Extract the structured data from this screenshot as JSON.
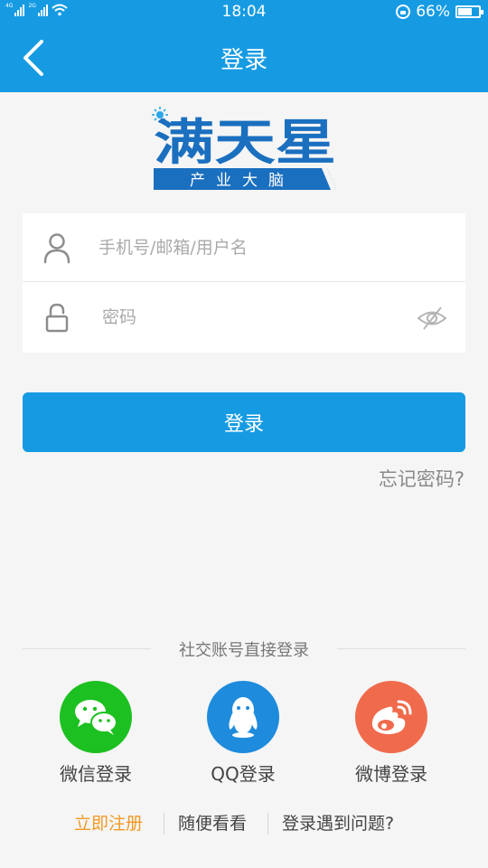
{
  "status_bar": {
    "network_1": "4G",
    "network_2": "2G",
    "time": "18:04",
    "battery_text": "66%",
    "battery_level": 0.66
  },
  "nav": {
    "title": "登录",
    "back_icon": "chevron-left-icon"
  },
  "logo": {
    "main_text": "满天星",
    "sub_text": "产业大脑",
    "colors": {
      "primary": "#1a6fbf",
      "light": "#2aa5e8"
    }
  },
  "form": {
    "username": {
      "icon": "user-icon",
      "placeholder": "手机号/邮箱/用户名",
      "value": ""
    },
    "password": {
      "icon": "lock-icon",
      "placeholder": "密码",
      "value": "",
      "toggle_icon": "eye-hidden-icon"
    }
  },
  "login_button": "登录",
  "forgot_password": "忘记密码?",
  "social": {
    "title": "社交账号直接登录",
    "items": [
      {
        "label": "微信登录",
        "icon": "wechat-icon",
        "color": "#1cc020"
      },
      {
        "label": "QQ登录",
        "icon": "qq-icon",
        "color": "#1e8bdc"
      },
      {
        "label": "微博登录",
        "icon": "weibo-icon",
        "color": "#f06a4c"
      }
    ]
  },
  "bottom_links": {
    "register": "立即注册",
    "browse": "随便看看",
    "help": "登录遇到问题?"
  },
  "colors": {
    "accent": "#169be3",
    "register_link": "#f29a24",
    "background": "#f5f5f5"
  }
}
